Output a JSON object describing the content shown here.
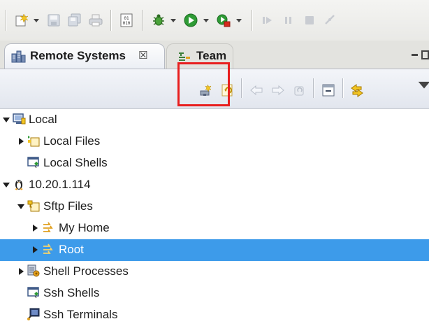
{
  "main_toolbar": {
    "icons": [
      "new-wizard-icon",
      "save-icon",
      "save-all-icon",
      "print-icon",
      "binary-icon",
      "debug-icon",
      "run-icon",
      "external-tools-icon",
      "resume-icon",
      "suspend-icon",
      "terminate-icon",
      "disconnect-icon"
    ]
  },
  "view": {
    "tab_label": "Remote Systems",
    "tab_close_glyph": "☒",
    "second_tab_label": "Team"
  },
  "view_toolbar": {
    "icons": [
      "define-connection-icon",
      "refresh-icon",
      "back-icon",
      "forward-icon",
      "up-icon",
      "collapse-all-icon",
      "link-with-editor-icon",
      "view-menu-icon"
    ]
  },
  "tree": {
    "items": [
      {
        "label": "Local",
        "expanded": true,
        "icon": "computer-icon"
      },
      {
        "label": "Local Files",
        "expanded": false,
        "icon": "local-files-icon"
      },
      {
        "label": "Local Shells",
        "icon": "shell-icon"
      },
      {
        "label": "10.20.1.114",
        "expanded": true,
        "icon": "linux-icon"
      },
      {
        "label": "Sftp Files",
        "expanded": true,
        "icon": "sftp-files-icon"
      },
      {
        "label": "My Home",
        "expanded": false,
        "icon": "filter-icon"
      },
      {
        "label": "Root",
        "expanded": false,
        "icon": "filter-icon",
        "selected": true
      },
      {
        "label": "Shell Processes",
        "expanded": false,
        "icon": "processes-icon"
      },
      {
        "label": "Ssh Shells",
        "icon": "shell-icon"
      },
      {
        "label": "Ssh Terminals",
        "icon": "terminal-icon"
      }
    ]
  },
  "colors": {
    "selection": "#3d9bea",
    "highlight_box": "#e81e1e"
  }
}
